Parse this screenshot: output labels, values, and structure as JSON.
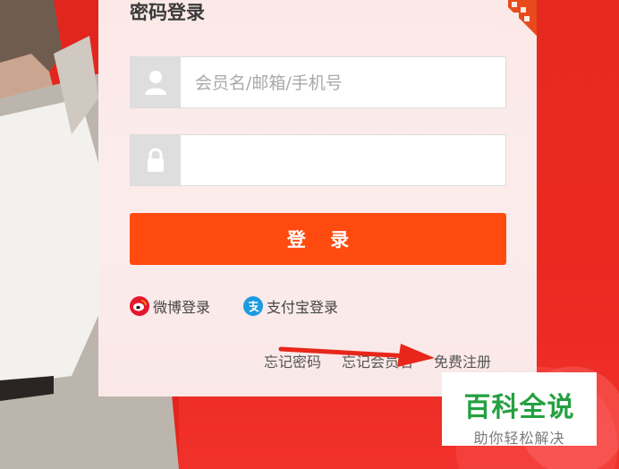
{
  "login": {
    "title": "密码登录",
    "username_placeholder": "会员名/邮箱/手机号",
    "password_placeholder": "",
    "submit_label": "登 录"
  },
  "social": {
    "weibo_label": "微博登录",
    "alipay_label": "支付宝登录"
  },
  "links": {
    "forgot_password": "忘记密码",
    "forgot_member": "忘记会员名",
    "register": "免费注册"
  },
  "watermark": {
    "main": "百科全说",
    "sub": "助你轻松解决"
  },
  "colors": {
    "accent": "#ff4b10",
    "background": "#e5241b",
    "weibo": "#e6162d",
    "alipay": "#1d9be0",
    "watermark_green": "#24a040"
  },
  "icons": [
    "user-icon",
    "lock-icon",
    "weibo-icon",
    "alipay-icon",
    "corner-qr-icon",
    "arrow-annotation"
  ]
}
